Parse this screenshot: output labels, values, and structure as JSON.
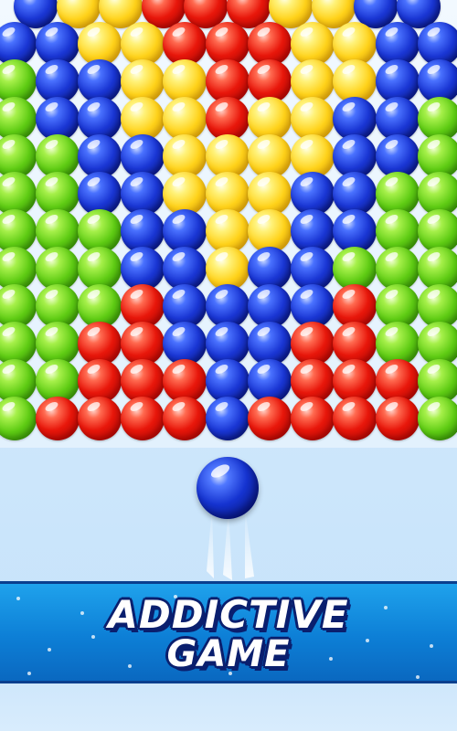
{
  "promo": {
    "line1": "ADDICTIVE",
    "line2": "GAME"
  },
  "colors": {
    "R": "#e8170b",
    "Y": "#ffd21a",
    "B": "#1a36d4",
    "G": "#5fcc14",
    "banner": "#0d7fd6",
    "banner_text_outline": "#0a1f6e"
  },
  "grid": {
    "rows": [
      [
        "B",
        "Y",
        "Y",
        "R",
        "R",
        "R",
        "Y",
        "Y",
        "B",
        "B"
      ],
      [
        "B",
        "B",
        "Y",
        "Y",
        "R",
        "R",
        "R",
        "Y",
        "Y",
        "B",
        "B"
      ],
      [
        "G",
        "B",
        "B",
        "Y",
        "Y",
        "R",
        "R",
        "Y",
        "Y",
        "B",
        "B"
      ],
      [
        "G",
        "B",
        "B",
        "Y",
        "Y",
        "R",
        "Y",
        "Y",
        "B",
        "B",
        "G"
      ],
      [
        "G",
        "G",
        "B",
        "B",
        "Y",
        "Y",
        "Y",
        "Y",
        "B",
        "B",
        "G"
      ],
      [
        "G",
        "G",
        "B",
        "B",
        "Y",
        "Y",
        "Y",
        "B",
        "B",
        "G",
        "G"
      ],
      [
        "G",
        "G",
        "G",
        "B",
        "B",
        "Y",
        "Y",
        "B",
        "B",
        "G",
        "G"
      ],
      [
        "G",
        "G",
        "G",
        "B",
        "B",
        "Y",
        "B",
        "B",
        "G",
        "G",
        "G"
      ],
      [
        "G",
        "G",
        "G",
        "R",
        "B",
        "B",
        "B",
        "B",
        "R",
        "G",
        "G"
      ],
      [
        "G",
        "G",
        "R",
        "R",
        "B",
        "B",
        "B",
        "R",
        "R",
        "G",
        "G"
      ],
      [
        "G",
        "G",
        "R",
        "R",
        "R",
        "B",
        "B",
        "R",
        "R",
        "R",
        "G"
      ],
      [
        "G",
        "R",
        "R",
        "R",
        "R",
        "B",
        "R",
        "R",
        "R",
        "R",
        "G"
      ]
    ]
  },
  "shooter": {
    "color": "B"
  }
}
